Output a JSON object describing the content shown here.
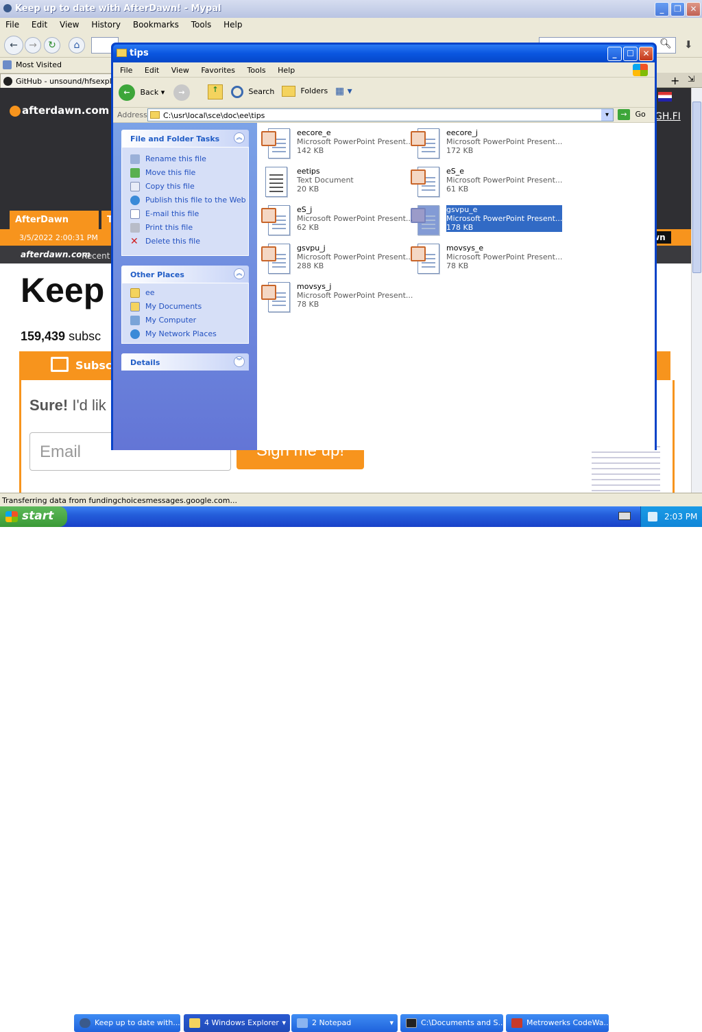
{
  "firefox": {
    "title": "Keep up to date with AfterDawn! - Mypal",
    "menu": [
      "File",
      "Edit",
      "View",
      "History",
      "Bookmarks",
      "Tools",
      "Help"
    ],
    "bookmarks": {
      "most_visited": "Most Visited"
    },
    "tab_title": "GitHub - unsound/hfsexplorer",
    "status": "Transferring data from fundingchoicesmessages.google.com..."
  },
  "page": {
    "logo": "afterdawn.com",
    "nav_home": "AfterDawn Home",
    "nav_partial": "T",
    "datetime": "3/5/2022 2:00:31 PM",
    "logo_small": "afterdawn.com",
    "recent": "Recent",
    "ghfi": "GH.FI",
    "right_label": "wn",
    "headline": "Keep",
    "subscribers": "159,439",
    "subscribers_suffix": "subsc",
    "subscribe_btn": "Subsc",
    "sure_bold": "Sure!",
    "sure_rest": " I'd lik",
    "email_placeholder": "Email",
    "signup": "Sign me up!"
  },
  "explorer": {
    "title": "tips",
    "menu": [
      "File",
      "Edit",
      "View",
      "Favorites",
      "Tools",
      "Help"
    ],
    "toolbar": {
      "back": "Back",
      "search": "Search",
      "folders": "Folders"
    },
    "address_label": "Address",
    "address": "C:\\usr\\local\\sce\\doc\\ee\\tips",
    "go": "Go",
    "tasks": {
      "title": "File and Folder Tasks",
      "items": [
        "Rename this file",
        "Move this file",
        "Copy this file",
        "Publish this file to the Web",
        "E-mail this file",
        "Print this file",
        "Delete this file"
      ]
    },
    "places": {
      "title": "Other Places",
      "items": [
        "ee",
        "My Documents",
        "My Computer",
        "My Network Places"
      ]
    },
    "details": {
      "title": "Details"
    },
    "files": [
      {
        "name": "eecore_e",
        "type": "Microsoft PowerPoint Present...",
        "size": "142 KB",
        "kind": "ppt",
        "selected": false
      },
      {
        "name": "eecore_j",
        "type": "Microsoft PowerPoint Present...",
        "size": "172 KB",
        "kind": "ppt",
        "selected": false
      },
      {
        "name": "eetips",
        "type": "Text Document",
        "size": "20 KB",
        "kind": "txt",
        "selected": false
      },
      {
        "name": "eS_e",
        "type": "Microsoft PowerPoint Present...",
        "size": "61 KB",
        "kind": "ppt",
        "selected": false
      },
      {
        "name": "eS_j",
        "type": "Microsoft PowerPoint Present...",
        "size": "62 KB",
        "kind": "ppt",
        "selected": false
      },
      {
        "name": "gsvpu_e",
        "type": "Microsoft PowerPoint Present...",
        "size": "178 KB",
        "kind": "ppt",
        "selected": true
      },
      {
        "name": "gsvpu_j",
        "type": "Microsoft PowerPoint Present...",
        "size": "288 KB",
        "kind": "ppt",
        "selected": false
      },
      {
        "name": "movsys_e",
        "type": "Microsoft PowerPoint Present...",
        "size": "78 KB",
        "kind": "ppt",
        "selected": false
      },
      {
        "name": "movsys_j",
        "type": "Microsoft PowerPoint Present...",
        "size": "78 KB",
        "kind": "ppt",
        "selected": false
      }
    ]
  },
  "taskbar": {
    "start": "start",
    "buttons": [
      "Keep up to date with...",
      "4 Windows Explorer",
      "2 Notepad",
      "C:\\Documents and S...",
      "Metrowerks CodeWa..."
    ],
    "clock": "2:03 PM"
  },
  "colors": {
    "xp_blue": "#0a246a",
    "title_blue": "#0055e5",
    "accent_orange": "#f7941d",
    "selection": "#316ac5"
  }
}
